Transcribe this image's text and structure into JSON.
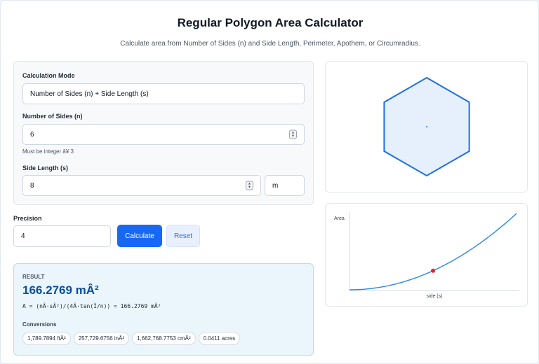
{
  "header": {
    "title": "Regular Polygon Area Calculator",
    "subtitle": "Calculate area from Number of Sides (n) and Side Length, Perimeter, Apothem, or Circumradius."
  },
  "form": {
    "mode_label": "Calculation Mode",
    "mode_value": "Number of Sides (n) + Side Length (s)",
    "sides_label": "Number of Sides (n)",
    "sides_value": "6",
    "sides_hint": "Must be integer â¥ 3",
    "side_length_label": "Side Length (s)",
    "side_length_value": "8",
    "unit_value": "m"
  },
  "controls": {
    "precision_label": "Precision",
    "precision_value": "4",
    "calculate_label": "Calculate",
    "reset_label": "Reset"
  },
  "result": {
    "label": "RESULT",
    "value": "166.2769 mÂ²",
    "formula": "A = (nÂ·sÂ²)/(4Â·tan(Ï/n)) = 166.2769 mÂ²",
    "conversions_label": "Conversions",
    "conversions": [
      "1,789.7894 ftÂ²",
      "257,729.6756 inÂ²",
      "1,662,768.7753 cmÂ²",
      "0.0411 acres"
    ]
  },
  "polygon_visual": {
    "sides": 6,
    "fill": "#e6effc",
    "stroke": "#1f6fe5"
  },
  "chart_data": {
    "type": "line",
    "ylabel": "Area",
    "xlabel": "side (s)",
    "series_color": "#2b87e8",
    "marker_color": "#e0262b",
    "curve": "A = 2.598076 · s²",
    "marker": {
      "s": 8,
      "area": 166.2769
    }
  }
}
